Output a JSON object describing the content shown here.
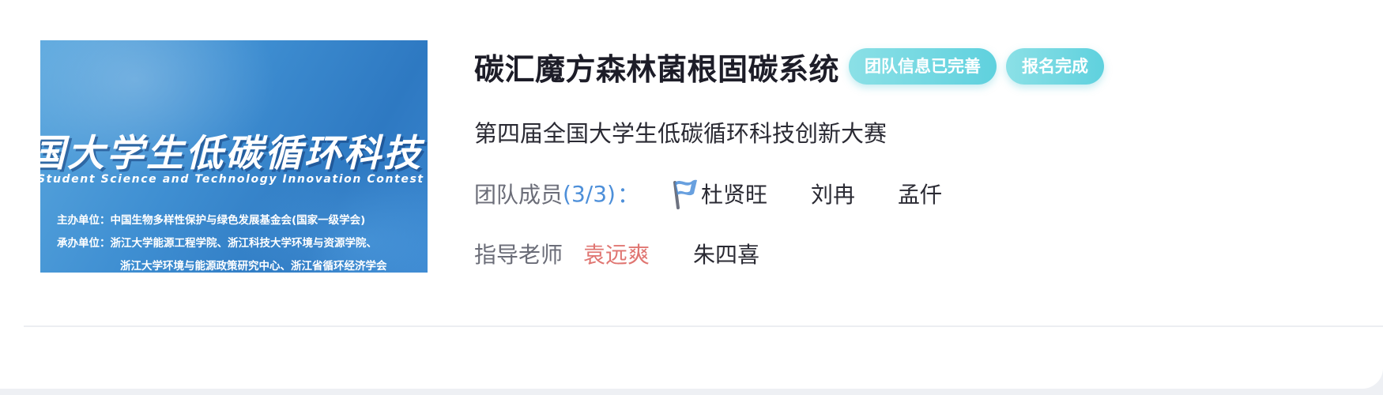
{
  "banner": {
    "title": "国大学生低碳循环科技",
    "subtitle": "Student Science and Technology Innovation Contest o",
    "line1": "主办单位：中国生物多样性保护与绿色发展基金会(国家一级学会)",
    "line2": "承办单位：浙江大学能源工程学院、浙江科技大学环境与资源学院、",
    "line3": "浙江大学环境与能源政策研究中心、浙江省循环经济学会"
  },
  "project": {
    "title": "碳汇魔方森林菌根固碳系统",
    "badges": [
      "团队信息已完善",
      "报名完成"
    ],
    "competition": "第四届全国大学生低碳循环科技创新大赛"
  },
  "team": {
    "label": "团队成员",
    "count": "(3/3)",
    "colon": "：",
    "leader_icon": "flag-icon",
    "members": [
      "杜贤旺",
      "刘冉",
      "孟仟"
    ]
  },
  "advisors": {
    "label": "指导老师",
    "names": [
      "袁远爽",
      "朱四喜"
    ]
  },
  "colors": {
    "badge": "#5fd1de",
    "count": "#4d8fd9",
    "advisor_highlight": "#e07672",
    "title": "#1d1d28"
  }
}
